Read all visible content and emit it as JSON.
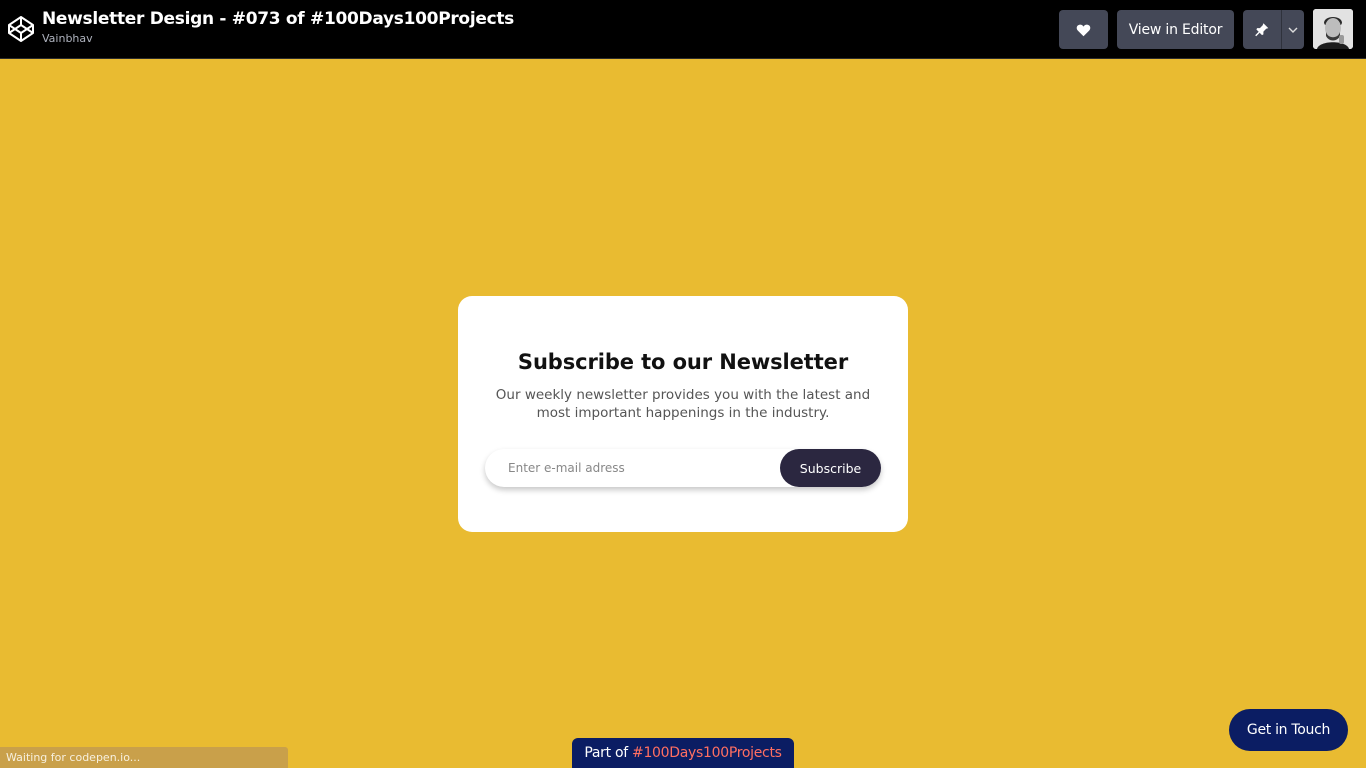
{
  "header": {
    "title": "Newsletter Design - #073 of #100Days100Projects",
    "author": "Vainbhav",
    "view_editor_label": "View in Editor",
    "icons": [
      "codepen-logo-icon",
      "heart-icon",
      "pin-icon",
      "chevron-down-icon"
    ]
  },
  "card": {
    "title": "Subscribe to our Newsletter",
    "description": "Our weekly newsletter provides you with the latest and most important happenings in the industry.",
    "email_placeholder": "Enter e-mail adress",
    "subscribe_label": "Subscribe"
  },
  "badge": {
    "prefix": "Part of ",
    "tag": "#100Days100Projects"
  },
  "contact_label": "Get in Touch",
  "status_text": "Waiting for codepen.io...",
  "colors": {
    "background": "#e9bb31",
    "topbar": "#000000",
    "button": "#444857",
    "subscribe": "#2b2740",
    "badge": "#0b1d63",
    "badge_tag": "#ff6f61"
  }
}
